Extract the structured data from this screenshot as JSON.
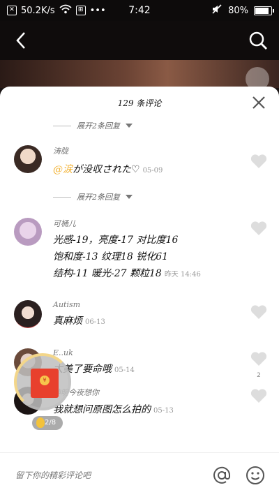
{
  "status_bar": {
    "net_speed": "50.2K/s",
    "time": "7:42",
    "battery": "80%"
  },
  "sheet": {
    "title": "129 条评论",
    "expand_label": "展开2条回复"
  },
  "comments": [
    {
      "user": "涛胧",
      "mention": "@涙",
      "text": "が没収された♡",
      "time": "05-09"
    },
    {
      "user": "可桶儿",
      "lines": [
        "光感-19，亮度-17 对比度16",
        "饱和度-13 纹理18 锐化61",
        "结构-11 暖光-27 颗粒18"
      ],
      "time": "昨天 14:46"
    },
    {
      "user": "Autism",
      "text": "真麻烦",
      "time": "06-13"
    },
    {
      "user": "E..uk",
      "text": "太美了要命哦",
      "time": "05-14",
      "likes": "2"
    },
    {
      "user": "神明今夜想你",
      "text": "我就想问原图怎么拍的",
      "time": "05-13"
    }
  ],
  "widget": {
    "progress": "2/8"
  },
  "input": {
    "placeholder": "留下你的精彩评论吧"
  },
  "colors": {
    "mention": "#f2b233",
    "envelope": "#e8402d"
  }
}
